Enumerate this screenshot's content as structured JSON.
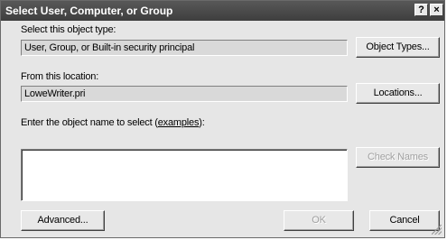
{
  "window": {
    "title": "Select User, Computer, or Group",
    "help_label": "?",
    "close_label": "×"
  },
  "object_type": {
    "label": "Select this object type:",
    "value": "User, Group, or Built-in security principal",
    "button": "Object Types..."
  },
  "location": {
    "label": "From this location:",
    "value": "LoweWriter.pri",
    "button": "Locations..."
  },
  "object_name": {
    "label_prefix": "Enter the object name to select (",
    "label_link": "examples",
    "label_suffix": "):",
    "value": "",
    "check_names_button": "Check Names"
  },
  "footer": {
    "advanced_button": "Advanced...",
    "ok_button": "OK",
    "cancel_button": "Cancel"
  }
}
